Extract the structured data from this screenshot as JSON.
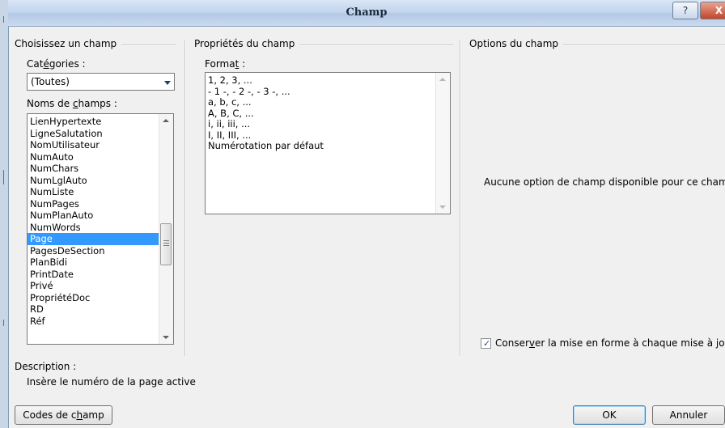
{
  "dialog": {
    "title": "Champ",
    "help_glyph": "?",
    "close_glyph": "X"
  },
  "choose_field": {
    "group_label": "Choisissez un champ",
    "categories_label": {
      "pre": "Cat",
      "key": "é",
      "post": "gories :"
    },
    "categories_value": "(Toutes)",
    "field_names_label": {
      "pre": "Noms de ",
      "key": "c",
      "post": "hamps :"
    },
    "field_names": [
      "LienHypertexte",
      "LigneSalutation",
      "NomUtilisateur",
      "NumAuto",
      "NumChars",
      "NumLglAuto",
      "NumListe",
      "NumPages",
      "NumPlanAuto",
      "NumWords",
      "Page",
      "PagesDeSection",
      "PlanBidi",
      "PrintDate",
      "Privé",
      "PropriétéDoc",
      "RD",
      "Réf"
    ],
    "selected_field": "Page"
  },
  "field_properties": {
    "group_label": "Propriétés du champ",
    "format_label": {
      "pre": "Forma",
      "key": "t",
      "post": " :"
    },
    "formats": [
      "1, 2, 3, ...",
      "- 1 -, - 2 -, - 3 -, ...",
      "a, b, c, ...",
      "A, B, C, ...",
      "i, ii, iii, ...",
      "I, II, III, ...",
      "Numérotation par défaut"
    ]
  },
  "field_options": {
    "group_label": "Options du champ",
    "empty_message": "Aucune option de champ disponible pour ce champ",
    "preserve_format": {
      "pre": "Conser",
      "key": "v",
      "post": "er la mise en forme à chaque mise à jour",
      "checked": true,
      "check_glyph": "✓"
    }
  },
  "description": {
    "label": "Description :",
    "text": "Insère le numéro de la page active"
  },
  "buttons": {
    "field_codes": {
      "pre": "Codes de c",
      "key": "h",
      "post": "amp"
    },
    "ok": "OK",
    "cancel": "Annuler"
  }
}
